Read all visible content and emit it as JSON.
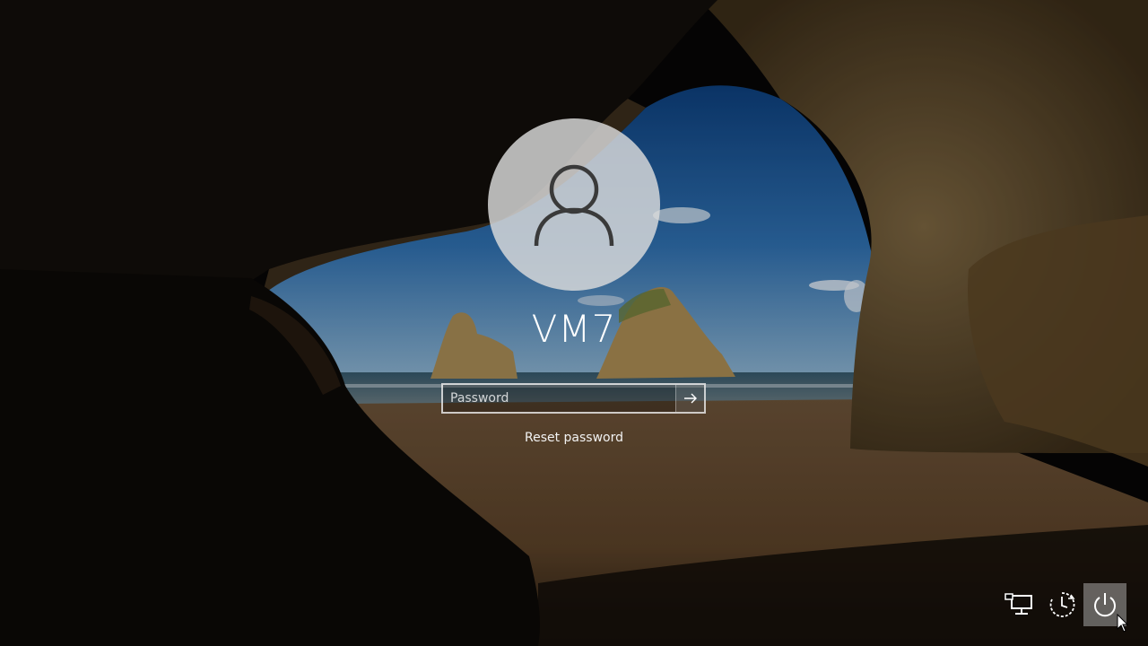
{
  "user": {
    "name": "VM7"
  },
  "password": {
    "placeholder": "Password",
    "value": ""
  },
  "reset_link": "Reset password",
  "tray": {
    "items": [
      {
        "icon": "network-icon"
      },
      {
        "icon": "ease-of-access-icon"
      },
      {
        "icon": "power-icon"
      }
    ]
  },
  "colors": {
    "text": "#ffffff",
    "avatar_bg": "#dcdcdc",
    "active_tray_bg": "#8c8c8c"
  }
}
